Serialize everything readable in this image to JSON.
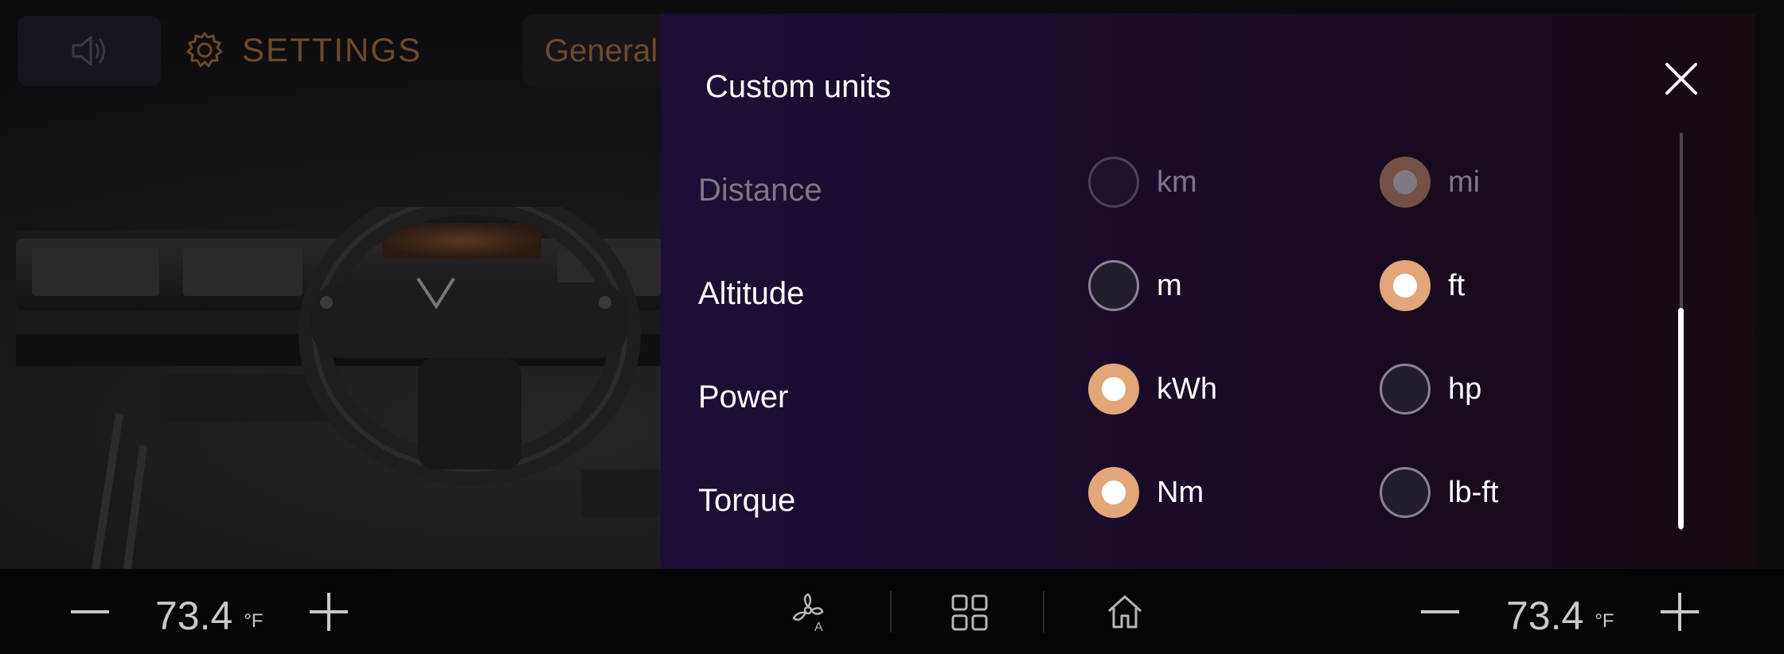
{
  "header": {
    "settings_title": "SETTINGS",
    "general_tab": "General"
  },
  "dialog": {
    "title": "Custom units",
    "rows": [
      {
        "label": "Distance",
        "options": [
          "km",
          "mi"
        ],
        "selected": "mi",
        "dimmed": true
      },
      {
        "label": "Altitude",
        "options": [
          "m",
          "ft"
        ],
        "selected": "ft",
        "dimmed": false
      },
      {
        "label": "Power",
        "options": [
          "kWh",
          "hp"
        ],
        "selected": "kWh",
        "dimmed": false
      },
      {
        "label": "Torque",
        "options": [
          "Nm",
          "lb-ft"
        ],
        "selected": "Nm",
        "dimmed": false
      }
    ]
  },
  "climate": {
    "left_temp": "73.4",
    "left_unit": "°F",
    "right_temp": "73.4",
    "right_unit": "°F"
  },
  "icons": [
    "speaker-icon",
    "gear-icon",
    "close-icon",
    "fan-auto-icon",
    "apps-grid-icon",
    "home-icon",
    "minus-icon",
    "plus-icon"
  ],
  "colors": {
    "accent": "#e2a679",
    "panel": "#1c0e37",
    "muted_text": "#6b4a2e"
  }
}
